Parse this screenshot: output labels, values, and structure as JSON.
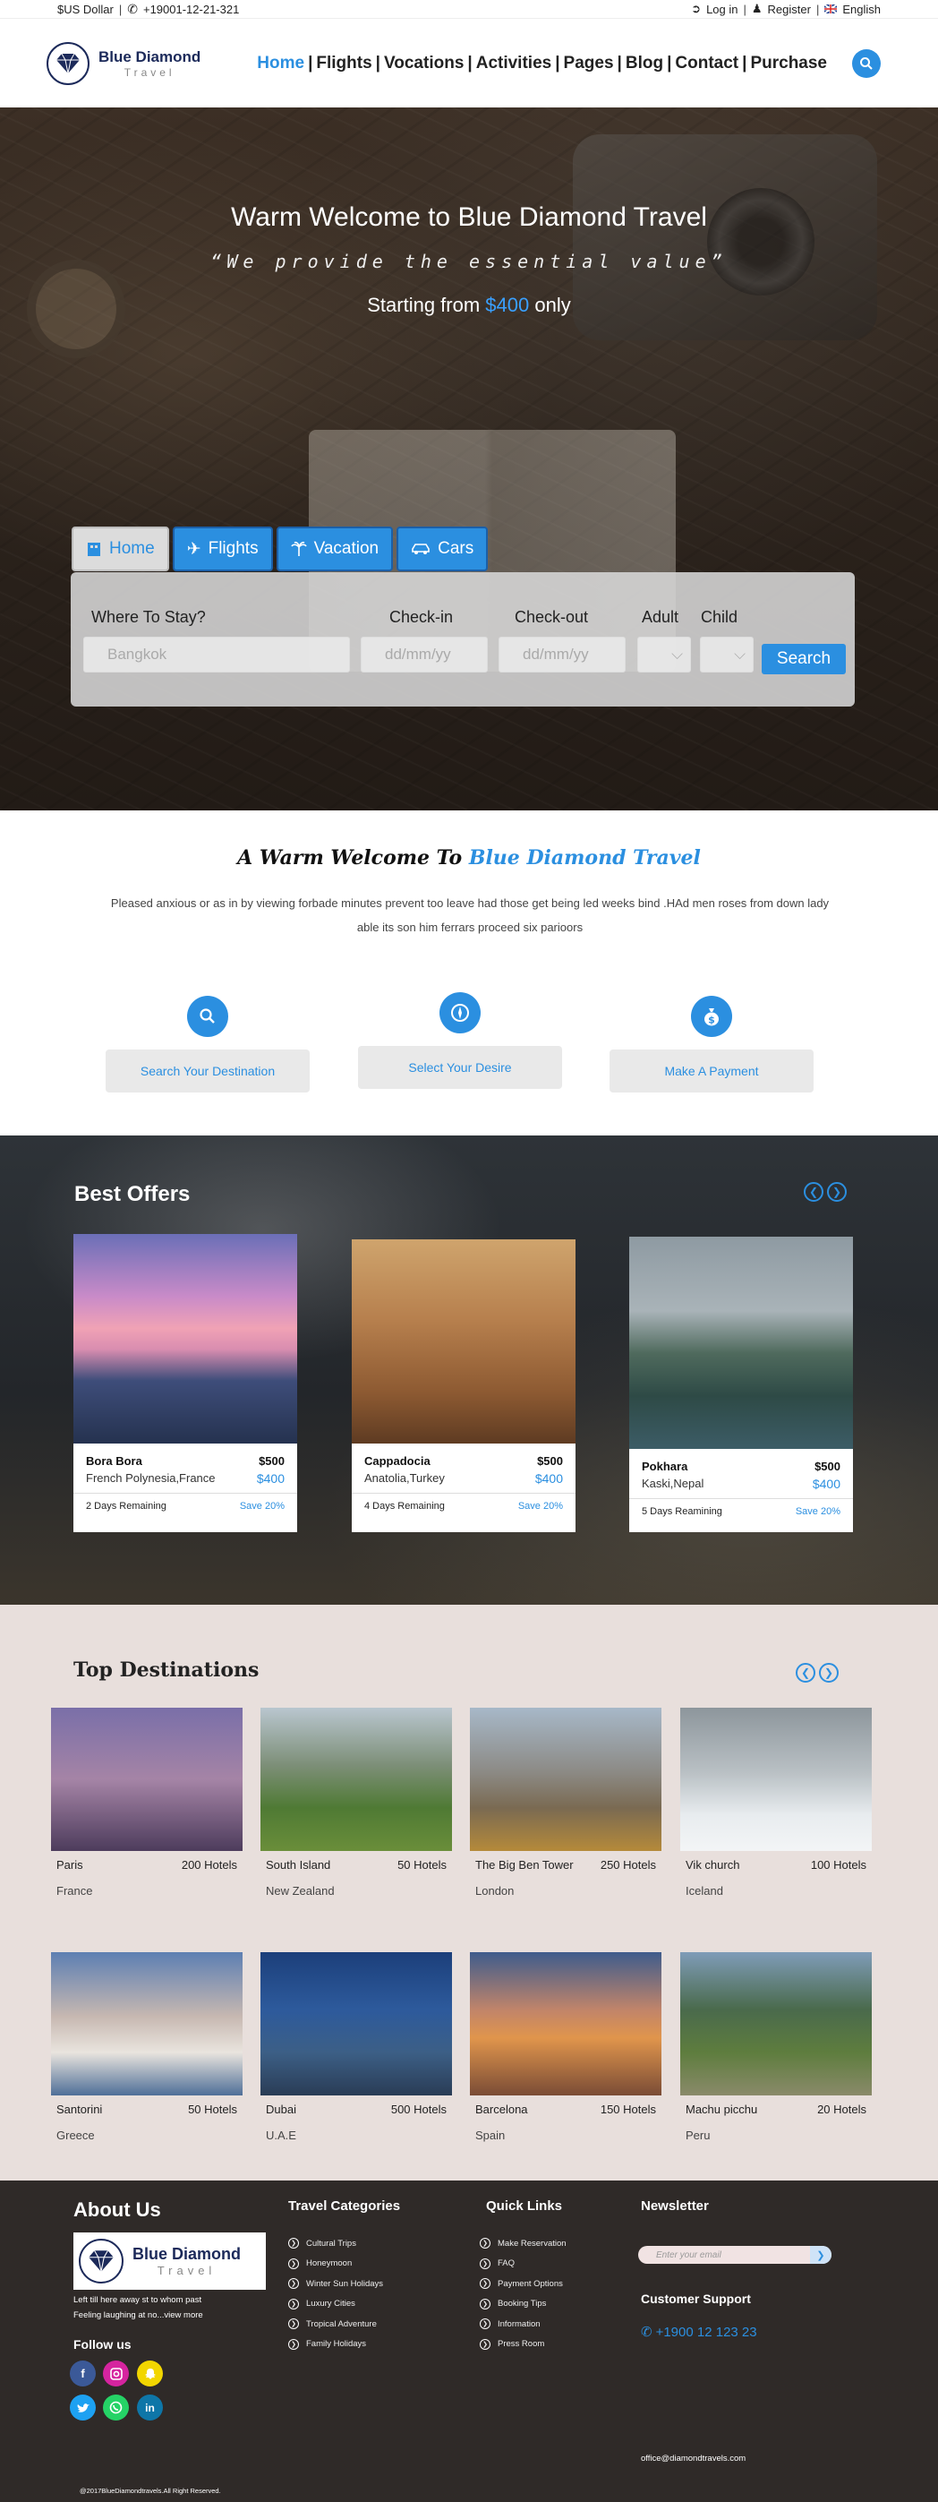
{
  "topbar": {
    "currency": "$US Dollar",
    "phone": "+19001-12-21-321",
    "login": "Log in",
    "register": "Register",
    "language": "English"
  },
  "header": {
    "logo_line1": "Blue Diamond",
    "logo_line2": "Travel",
    "nav": [
      "Home",
      "Flights",
      "Vocations",
      "Activities",
      "Pages",
      "Blog",
      "Contact",
      "Purchase"
    ]
  },
  "hero": {
    "title": "Warm Welcome to  Blue Diamond Travel",
    "subtitle": "“We provide the essential value”",
    "price_prefix": "Starting from ",
    "price_amount": "$400",
    "price_suffix": " only",
    "tabs": [
      "Home",
      "Flights",
      "Vacation",
      "Cars"
    ],
    "search": {
      "where_label": "Where To Stay?",
      "where_placeholder": "Bangkok",
      "checkin_label": "Check-in",
      "checkin_placeholder": "dd/mm/yy",
      "checkout_label": "Check-out",
      "checkout_placeholder": "dd/mm/yy",
      "adult_label": "Adult",
      "child_label": "Child",
      "button": "Search"
    }
  },
  "welcome": {
    "title_prefix": "A Warm Welcome To ",
    "title_brand": "Blue Diamond Travel",
    "text": "Pleased anxious or as in by viewing forbade minutes prevent too leave had those get being led weeks bind .HAd men roses from down lady able its son him ferrars proceed six parioors",
    "steps": [
      "Search Your Destination",
      "Select Your Desire",
      "Make A Payment"
    ]
  },
  "offers": {
    "title": "Best Offers",
    "cards": [
      {
        "name": "Bora Bora",
        "price": "$500",
        "location": "French Polynesia,France",
        "price2": "$400",
        "days": "2 Days Remaining",
        "save": "Save  20%"
      },
      {
        "name": "Cappadocia",
        "price": "$500",
        "location": "Anatolia,Turkey",
        "price2": "$400",
        "days": "4 Days Remaining",
        "save": "Save 20%"
      },
      {
        "name": "Pokhara",
        "price": "$500",
        "location": "Kaski,Nepal",
        "price2": "$400",
        "days": "5 Days Reamining",
        "save": "Save  20%"
      }
    ]
  },
  "destinations": {
    "title": "Top Destinations",
    "items": [
      {
        "name": "Paris",
        "hotels": "200 Hotels",
        "country": "France"
      },
      {
        "name": "South Island",
        "hotels": "50 Hotels",
        "country": "New Zealand"
      },
      {
        "name": "The Big Ben Tower",
        "hotels": "250 Hotels",
        "country": "London"
      },
      {
        "name": "Vik church",
        "hotels": "100 Hotels",
        "country": "Iceland"
      },
      {
        "name": "Santorini",
        "hotels": "50 Hotels",
        "country": "Greece"
      },
      {
        "name": "Dubai",
        "hotels": "500 Hotels",
        "country": "U.A.E"
      },
      {
        "name": "Barcelona",
        "hotels": "150 Hotels",
        "country": "Spain"
      },
      {
        "name": "Machu picchu",
        "hotels": "20 Hotels",
        "country": "Peru"
      }
    ]
  },
  "footer": {
    "about_title": "About Us",
    "about_logo1": "Blue Diamond",
    "about_logo2": "Travel",
    "about_text1": "Left till here away st to whom past",
    "about_text2": "Feeling laughing at no...view more",
    "follow": "Follow us",
    "categories_title": "Travel Categories",
    "categories": [
      "Cultural Trips",
      "Honeymoon",
      "Winter Sun Holidays",
      "Luxury Cities",
      "Tropical Adventure",
      "Family Holidays"
    ],
    "links_title": "Quick Links",
    "links": [
      "Make Reservation",
      "FAQ",
      "Payment Options",
      "Booking Tips",
      "Information",
      "Press Room"
    ],
    "newsletter_title": "Newsletter",
    "newsletter_placeholder": "Enter your email",
    "support_title": "Customer Support",
    "support_phone": "+1900 12 123 23",
    "email": "office@diamondtravels.com",
    "copyright": "@2017BlueDiamondtravels.All Right Reserved."
  }
}
